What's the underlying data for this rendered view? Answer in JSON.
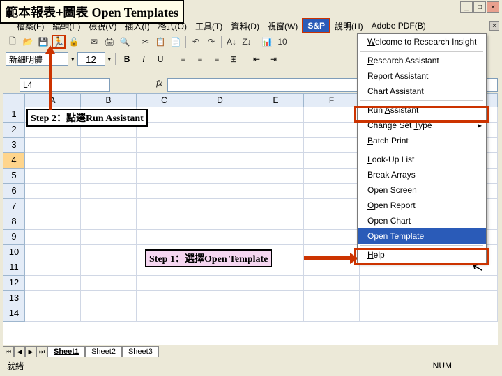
{
  "banner": {
    "zh": "範本報表+圖表 ",
    "en": "Open Templates"
  },
  "menu": [
    "檔案(F)",
    "編輯(E)",
    "檢視(V)",
    "插入(I)",
    "格式(O)",
    "工具(T)",
    "資料(D)",
    "視窗(W)",
    "S&P",
    "說明(H)",
    "Adobe PDF(B)"
  ],
  "toolbar": {
    "zoom": "10"
  },
  "format": {
    "font": "新細明體",
    "size": "12"
  },
  "namebox": "L4",
  "fx": "fx",
  "cols": [
    "A",
    "B",
    "C",
    "D",
    "E",
    "F"
  ],
  "rows": [
    "1",
    "2",
    "3",
    "4",
    "5",
    "6",
    "7",
    "8",
    "9",
    "10",
    "11",
    "12",
    "13",
    "14"
  ],
  "selected_row": "4",
  "step1": "Step 1：選擇Open Template",
  "step2": "Step 2：點選Run Assistant",
  "dropdown": [
    {
      "t": "Welcome to Research Insight",
      "u": "W"
    },
    {
      "sep": true
    },
    {
      "t": "Research Assistant",
      "u": "R"
    },
    {
      "t": "Report Assistant"
    },
    {
      "t": "Chart Assistant",
      "u": "C"
    },
    {
      "sep": true
    },
    {
      "t": "Run Assistant",
      "u": "A",
      "hl": "run"
    },
    {
      "t": "Change Set Type",
      "u": "T",
      "sub": true
    },
    {
      "t": "Batch Print",
      "u": "B"
    },
    {
      "sep": true
    },
    {
      "t": "Look-Up List",
      "u": "L"
    },
    {
      "t": "Break Arrays"
    },
    {
      "t": "Open Screen",
      "u": "S"
    },
    {
      "t": "Open Report",
      "u": "O"
    },
    {
      "t": "Open Chart"
    },
    {
      "t": "Open Template",
      "hover": true,
      "hl": "open"
    },
    {
      "sep": true
    },
    {
      "t": "Help",
      "u": "H"
    }
  ],
  "tabs": [
    "Sheet1",
    "Sheet2",
    "Sheet3"
  ],
  "status": {
    "ready": "就緒",
    "num": "NUM"
  }
}
